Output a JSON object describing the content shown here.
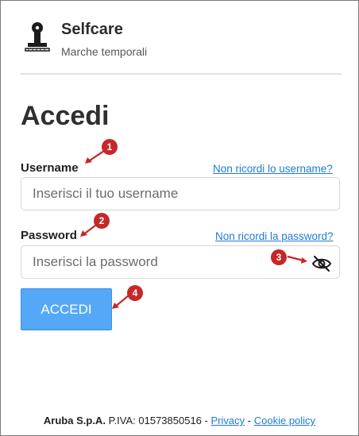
{
  "header": {
    "title": "Selfcare",
    "subtitle": "Marche temporali"
  },
  "page_title": "Accedi",
  "username": {
    "label": "Username",
    "forgot_link": "Non ricordi lo username?",
    "placeholder": "Inserisci il tuo username",
    "value": ""
  },
  "password": {
    "label": "Password",
    "forgot_link": "Non ricordi la password?",
    "placeholder": "Inserisci la password",
    "value": "",
    "toggle_icon": "eye-off-icon"
  },
  "login_button": "ACCEDI",
  "annotations": [
    "1",
    "2",
    "3",
    "4"
  ],
  "footer": {
    "company": "Aruba S.p.A.",
    "vat": "P.IVA: 01573850516",
    "sep1": "-",
    "privacy": "Privacy",
    "sep2": "-",
    "cookie": "Cookie policy"
  },
  "colors": {
    "accent": "#55a8f7",
    "link": "#1f7ad6",
    "annotation": "#c62828"
  }
}
